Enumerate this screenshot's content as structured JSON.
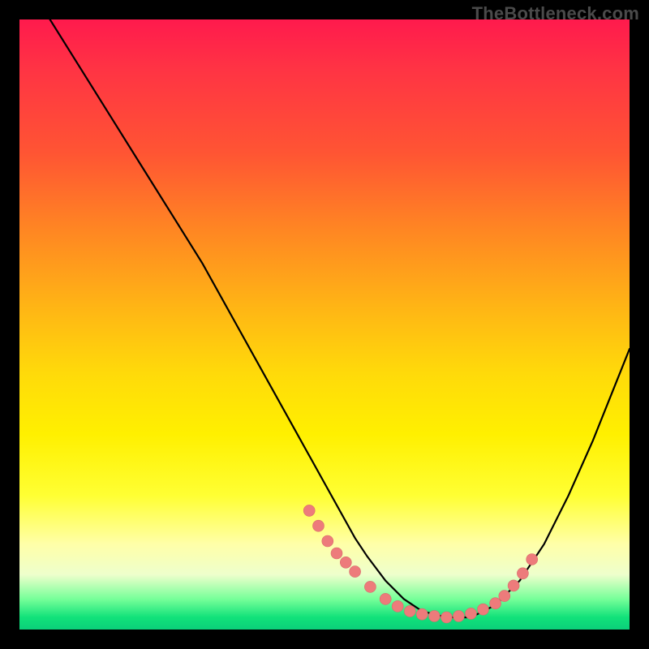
{
  "watermark": "TheBottleneck.com",
  "colors": {
    "dot": "#ed7b7b",
    "curve": "#000000"
  },
  "chart_data": {
    "type": "line",
    "title": "",
    "xlabel": "",
    "ylabel": "",
    "xlim": [
      0,
      100
    ],
    "ylim": [
      0,
      100
    ],
    "series": [
      {
        "name": "bottleneck-curve",
        "x": [
          5,
          10,
          15,
          20,
          25,
          30,
          35,
          40,
          45,
          50,
          55,
          57,
          60,
          63,
          66,
          70,
          74,
          78,
          82,
          86,
          90,
          94,
          98,
          100
        ],
        "y": [
          100,
          92,
          84,
          76,
          68,
          60,
          51,
          42,
          33,
          24,
          15,
          12,
          8,
          5,
          3,
          2,
          2,
          4,
          8,
          14,
          22,
          31,
          41,
          46
        ]
      }
    ],
    "markers": {
      "name": "highlight-dots",
      "x": [
        47.5,
        49.0,
        50.5,
        52.0,
        53.5,
        55.0,
        57.5,
        60.0,
        62.0,
        64.0,
        66.0,
        68.0,
        70.0,
        72.0,
        74.0,
        76.0,
        78.0,
        79.5,
        81.0,
        82.5,
        84.0
      ],
      "y": [
        19.5,
        17.0,
        14.5,
        12.5,
        11.0,
        9.5,
        7.0,
        5.0,
        3.8,
        3.0,
        2.5,
        2.2,
        2.0,
        2.2,
        2.6,
        3.3,
        4.3,
        5.5,
        7.2,
        9.2,
        11.5
      ]
    }
  }
}
